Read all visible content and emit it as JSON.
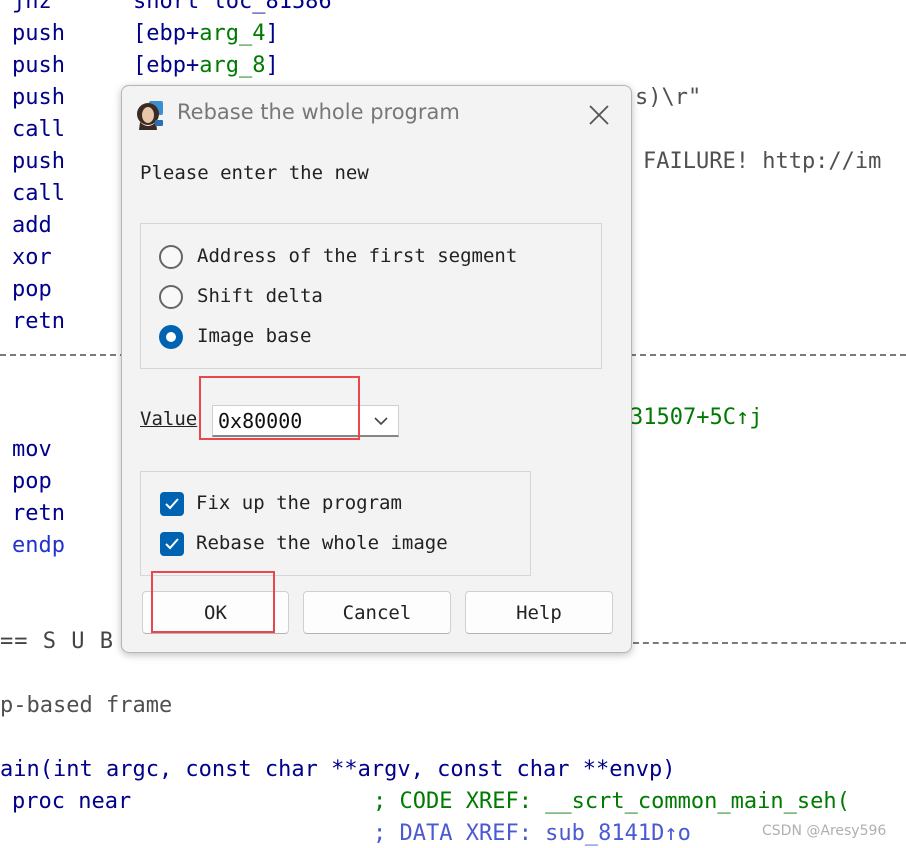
{
  "background_code": {
    "lines_top": [
      {
        "mnemonic": "jnz",
        "operand": "short loc_81586"
      },
      {
        "mnemonic": "push",
        "operand_prefix": "[ebp+",
        "operand_arg": "arg_4",
        "operand_suffix": "]"
      },
      {
        "mnemonic": "push",
        "operand_prefix": "[ebp+",
        "operand_arg": "arg_8",
        "operand_suffix": "]"
      },
      {
        "mnemonic": "push",
        "right_fragment": "s)\\r\""
      },
      {
        "mnemonic": "call"
      },
      {
        "mnemonic": "push",
        "right_fragment": "FAILURE! http://im"
      },
      {
        "mnemonic": "call"
      },
      {
        "mnemonic": "add"
      },
      {
        "mnemonic": "xor"
      },
      {
        "mnemonic": "pop"
      },
      {
        "mnemonic": "retn"
      }
    ],
    "xref_fragment": "31507+5C↑j",
    "lines_bottom": [
      {
        "mnemonic": "mov"
      },
      {
        "mnemonic": "pop"
      },
      {
        "mnemonic": "retn"
      },
      {
        "mnemonic": "endp"
      }
    ],
    "sub_marker_left": "== S U B",
    "frame_comment": "p-based frame",
    "main_signature": "ain(int argc, const char **argv, const char **envp)",
    "proc_line": {
      "name": "proc near",
      "comment": "; CODE XREF: __scrt_common_main_seh("
    },
    "data_xref": "; DATA XREF: sub_8141D↑o"
  },
  "dialog": {
    "title": "Rebase the whole program",
    "prompt": "Please enter the new",
    "options": [
      {
        "label": "Address of the first segment",
        "selected": false
      },
      {
        "label": "Shift delta",
        "selected": false
      },
      {
        "label": "Image base",
        "selected": true
      }
    ],
    "value_label": "Value",
    "value": "0x80000",
    "checkboxes": [
      {
        "label": "Fix up the program",
        "checked": true
      },
      {
        "label": "Rebase the whole image",
        "checked": true
      }
    ],
    "buttons": {
      "ok": "OK",
      "cancel": "Cancel",
      "help": "Help"
    }
  },
  "watermark": "CSDN @Aresy596",
  "colors": {
    "accent": "#0063b1",
    "highlight_box": "#e8474b",
    "code_navy": "#00008b",
    "code_green": "#007a00",
    "code_blue": "#2233cc"
  }
}
